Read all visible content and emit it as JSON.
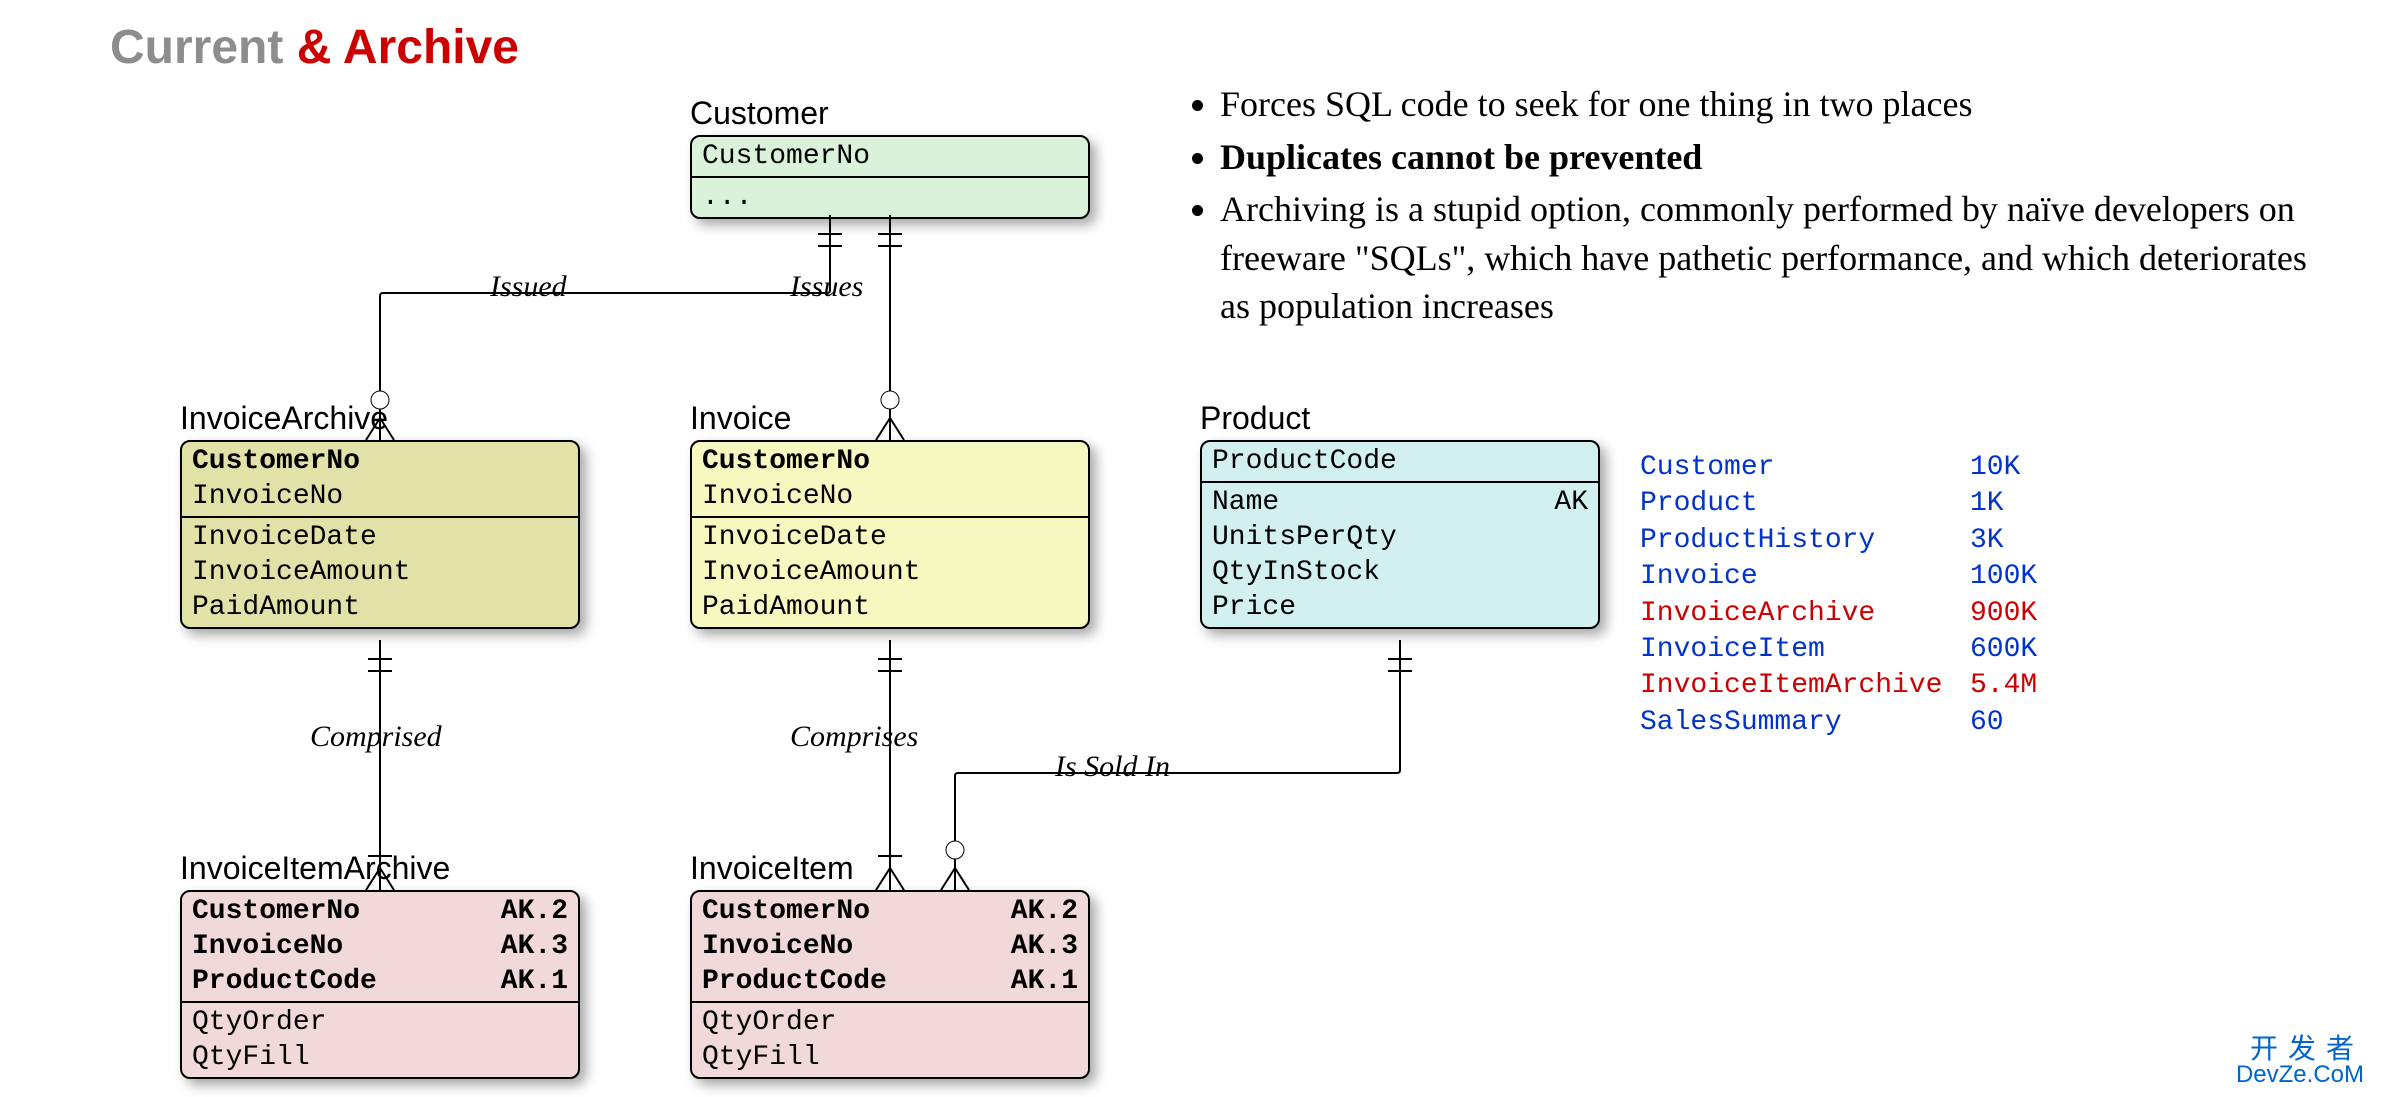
{
  "title": {
    "left": "Current ",
    "right": "& Archive"
  },
  "entities": {
    "customer": {
      "label": "Customer",
      "pk": [
        "CustomerNo"
      ],
      "rest": [
        "..."
      ]
    },
    "invoice_archive": {
      "label": "InvoiceArchive",
      "pk": [
        "CustomerNo",
        "InvoiceNo"
      ],
      "attrs": [
        "InvoiceDate",
        "InvoiceAmount",
        "PaidAmount"
      ]
    },
    "invoice": {
      "label": "Invoice",
      "pk": [
        "CustomerNo",
        "InvoiceNo"
      ],
      "attrs": [
        "InvoiceDate",
        "InvoiceAmount",
        "PaidAmount"
      ]
    },
    "product": {
      "label": "Product",
      "pk": [
        "ProductCode"
      ],
      "rows": [
        {
          "name": "Name",
          "ak": "AK"
        },
        {
          "name": "UnitsPerQty"
        },
        {
          "name": "QtyInStock"
        },
        {
          "name": "Price"
        }
      ]
    },
    "invoice_item_archive": {
      "label": "InvoiceItemArchive",
      "pk": [
        {
          "name": "CustomerNo",
          "ak": "AK.2"
        },
        {
          "name": "InvoiceNo",
          "ak": "AK.3"
        },
        {
          "name": "ProductCode",
          "ak": "AK.1"
        }
      ],
      "attrs": [
        "QtyOrder",
        "QtyFill"
      ]
    },
    "invoice_item": {
      "label": "InvoiceItem",
      "pk": [
        {
          "name": "CustomerNo",
          "ak": "AK.2"
        },
        {
          "name": "InvoiceNo",
          "ak": "AK.3"
        },
        {
          "name": "ProductCode",
          "ak": "AK.1"
        }
      ],
      "attrs": [
        "QtyOrder",
        "QtyFill"
      ]
    }
  },
  "relationships": {
    "issued": "Issued",
    "issues": "Issues",
    "comprised": "Comprised",
    "comprises": "Comprises",
    "is_sold_in": "Is Sold In"
  },
  "bullets": [
    {
      "text": "Forces SQL code to seek for one thing in two places",
      "bold": false
    },
    {
      "text": "Duplicates cannot be prevented",
      "bold": true
    },
    {
      "text": "Archiving is a stupid option, commonly performed by naïve developers on freeware \"SQLs\", which have pathetic performance, and which deteriorates as population increases",
      "bold": false
    }
  ],
  "stats": [
    {
      "name": "Customer",
      "value": "10K",
      "color": "blue"
    },
    {
      "name": "Product",
      "value": "1K",
      "color": "blue"
    },
    {
      "name": "ProductHistory",
      "value": "3K",
      "color": "blue"
    },
    {
      "name": "Invoice",
      "value": "100K",
      "color": "blue"
    },
    {
      "name": "InvoiceArchive",
      "value": "900K",
      "color": "red"
    },
    {
      "name": "InvoiceItem",
      "value": "600K",
      "color": "blue"
    },
    {
      "name": "InvoiceItemArchive",
      "value": "5.4M",
      "color": "red"
    },
    {
      "name": "SalesSummary",
      "value": "60",
      "color": "blue"
    }
  ],
  "watermark": {
    "cn": "开发者",
    "en": "DevZe.CoM"
  }
}
